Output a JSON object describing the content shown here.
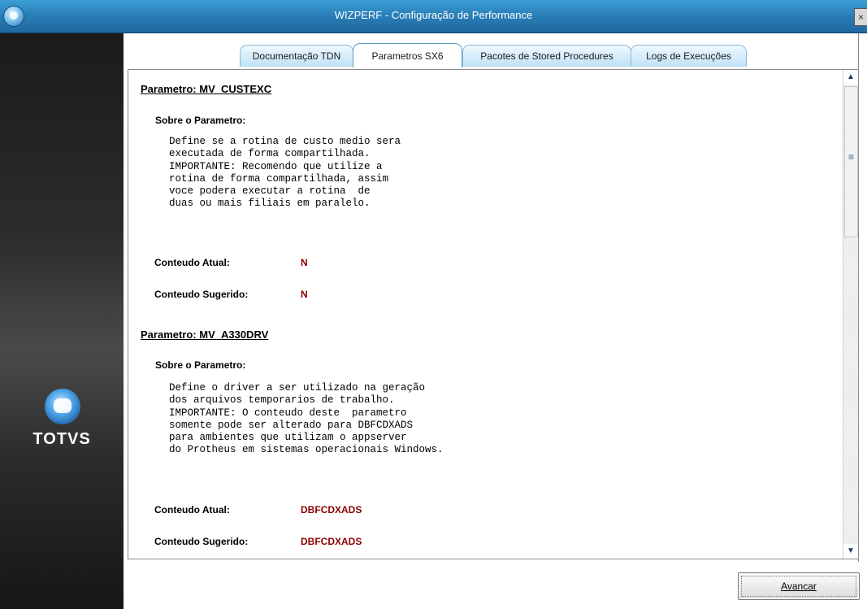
{
  "window": {
    "title": "WIZPERF - Configuração de Performance",
    "close_label": "×"
  },
  "sidebar": {
    "logo_text": "TOTVS"
  },
  "tabs": [
    {
      "label": "Documentação TDN",
      "active": false
    },
    {
      "label": "Parametros SX6",
      "active": true
    },
    {
      "label": "Pacotes de Stored Procedures",
      "active": false
    },
    {
      "label": "Logs de Execuções",
      "active": false
    }
  ],
  "params": [
    {
      "title": "Parametro: MV_CUSTEXC",
      "about_label": "Sobre o Parametro:",
      "description": "Define se a rotina de custo medio sera\nexecutada de forma compartilhada.\nIMPORTANTE: Recomendo que utilize a\nrotina de forma compartilhada, assim\nvoce podera executar a rotina  de\nduas ou mais filiais em paralelo.",
      "current_label": "Conteudo Atual:",
      "current_value": "N",
      "suggested_label": "Conteudo Sugerido:",
      "suggested_value": "N"
    },
    {
      "title": "Parametro: MV_A330DRV",
      "about_label": "Sobre o Parametro:",
      "description": "Define o driver a ser utilizado na geração\ndos arquivos temporarios de trabalho.\nIMPORTANTE: O conteudo deste  parametro\nsomente pode ser alterado para DBFCDXADS\npara ambientes que utilizam o appserver\ndo Protheus em sistemas operacionais Windows.",
      "current_label": "Conteudo Atual:",
      "current_value": "DBFCDXADS",
      "suggested_label": "Conteudo Sugerido:",
      "suggested_value": "DBFCDXADS"
    }
  ],
  "scrollbar": {
    "up_icon": "▲",
    "down_icon": "▼",
    "grip_icon": "≡"
  },
  "footer": {
    "next_label": "Avancar"
  },
  "colors": {
    "value_color": "#8b0000",
    "titlebar": "#2b7fb8"
  }
}
